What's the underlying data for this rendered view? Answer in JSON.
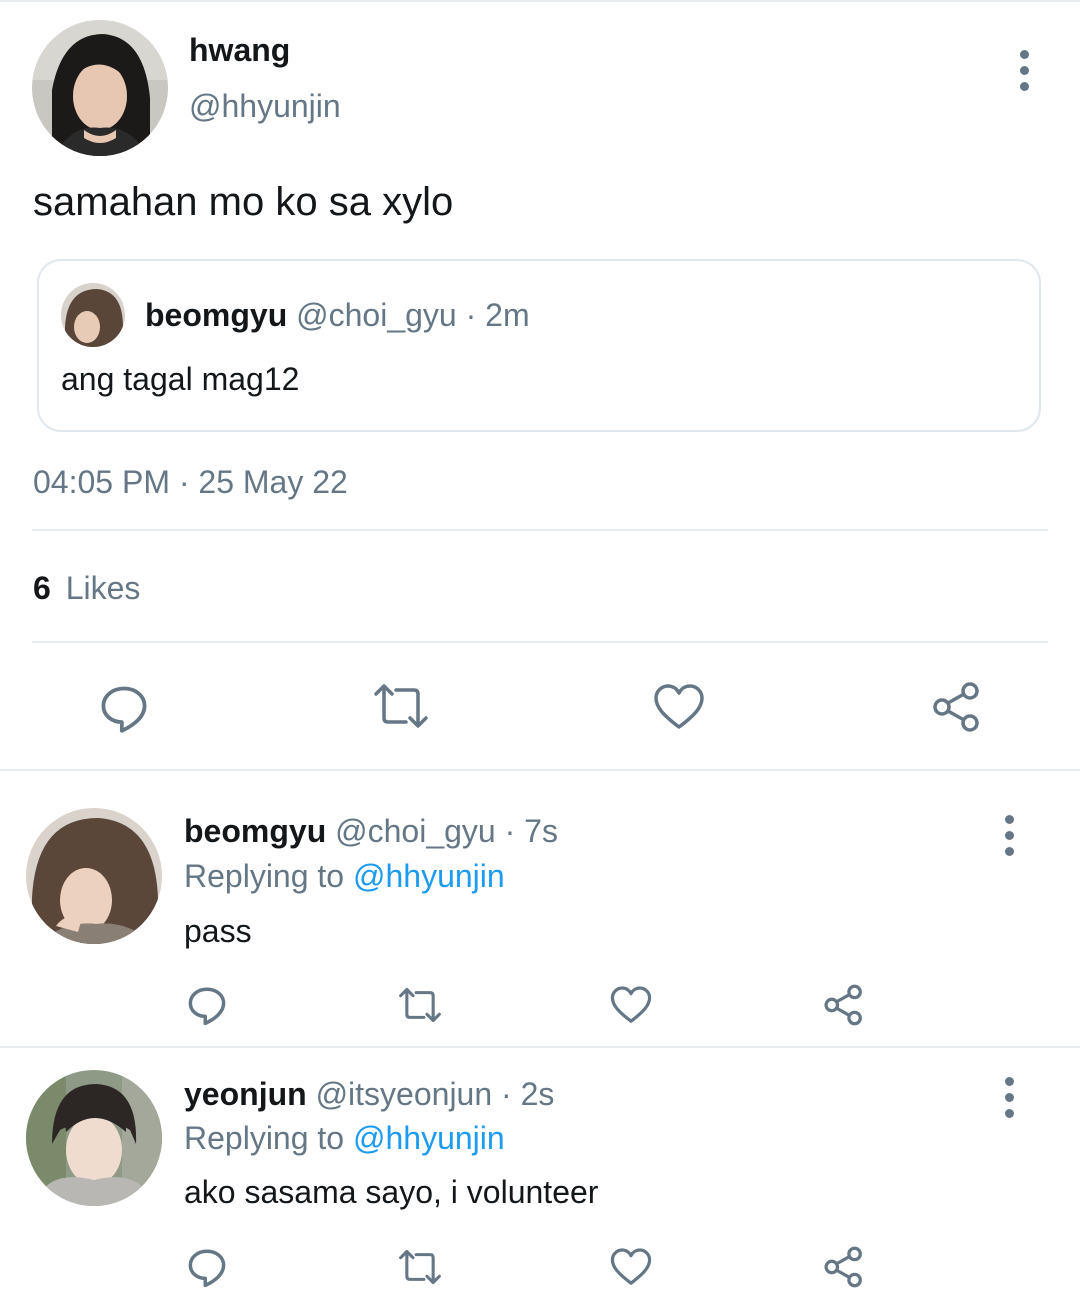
{
  "tweet": {
    "display_name": "hwang",
    "handle": "@hhyunjin",
    "text": "samahan mo ko sa xylo",
    "timestamp": "04:05 PM · 25 May 22",
    "likes_count": "6",
    "likes_label": "Likes",
    "quoted": {
      "display_name": "beomgyu",
      "meta": "@choi_gyu · 2m",
      "text": "ang tagal mag12"
    }
  },
  "actions": {
    "icons": [
      "reply-icon",
      "retweet-icon",
      "like-icon",
      "share-icon"
    ]
  },
  "replies": [
    {
      "display_name": "beomgyu",
      "meta": "@choi_gyu · 7s",
      "replying_prefix": "Replying to",
      "replying_handle": "@hhyunjin",
      "text": "pass"
    },
    {
      "display_name": "yeonjun",
      "meta": "@itsyeonjun · 2s",
      "replying_prefix": "Replying to",
      "replying_handle": "@hhyunjin",
      "text": "ako sasama sayo, i volunteer"
    }
  ],
  "colors": {
    "text": "#14171a",
    "secondary": "#657786",
    "link": "#1d9bf0",
    "divider": "#e6ecf0"
  }
}
